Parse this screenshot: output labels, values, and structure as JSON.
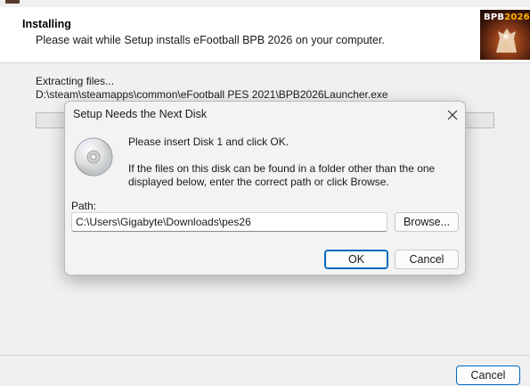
{
  "header": {
    "title": "Installing",
    "subtitle": "Please wait while Setup installs eFootball BPB 2026 on your computer.",
    "logo_text_a": "BPB",
    "logo_text_b": "2026"
  },
  "body": {
    "status": "Extracting files...",
    "file_path": "D:\\steam\\steamapps\\common\\eFootball PES 2021\\BPB2026Launcher.exe",
    "progress": 0
  },
  "footer": {
    "cancel_label": "Cancel"
  },
  "dialog": {
    "title": "Setup Needs the Next Disk",
    "message1": "Please insert Disk 1 and click OK.",
    "message2": "If the files on this disk can be found in a folder other than the one displayed below, enter the correct path or click Browse.",
    "path_label": "Path:",
    "path_value": "C:\\Users\\Gigabyte\\Downloads\\pes26",
    "browse_label": "Browse...",
    "ok_label": "OK",
    "cancel_label": "Cancel"
  },
  "icons": {
    "close": "close-icon",
    "disk": "disc-icon",
    "app": "app-icon"
  },
  "colors": {
    "accent": "#0067c0",
    "logo_yellow": "#ffb400",
    "logo_bg": "#8a3a18"
  }
}
